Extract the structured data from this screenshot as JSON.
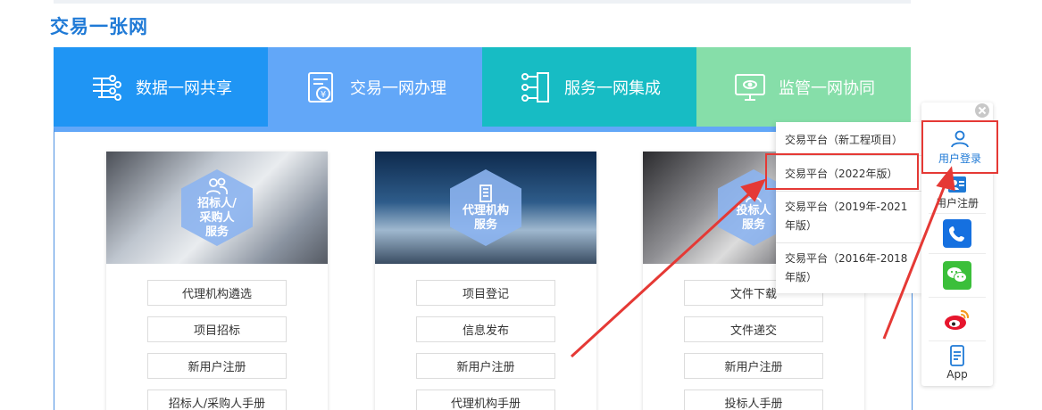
{
  "section": {
    "title": "交易一张网"
  },
  "tabs": [
    {
      "label": "数据一网共享",
      "icon": "data-share-icon"
    },
    {
      "label": "交易一网办理",
      "icon": "transaction-icon"
    },
    {
      "label": "服务一网集成",
      "icon": "service-integration-icon"
    },
    {
      "label": "监管一网协同",
      "icon": "monitor-icon"
    }
  ],
  "cards": [
    {
      "badge_line1": "招标人/",
      "badge_line2": "采购人",
      "badge_line3": "服务",
      "links": [
        "代理机构遴选",
        "项目招标",
        "新用户注册",
        "招标人/采购人手册"
      ]
    },
    {
      "badge_line1": "代理机构",
      "badge_line2": "服务",
      "links": [
        "项目登记",
        "信息发布",
        "新用户注册",
        "代理机构手册"
      ]
    },
    {
      "badge_line1": "投标人",
      "badge_line2": "服务",
      "links": [
        "文件下载",
        "文件递交",
        "新用户注册",
        "投标人手册"
      ]
    }
  ],
  "dropdown": {
    "items": [
      "交易平台（新工程项目）",
      "交易平台（2022年版）",
      "交易平台（2019年-2021年版）",
      "交易平台（2016年-2018年版）"
    ]
  },
  "sidebar": {
    "login_label": "用户登录",
    "register_label": "用户注册",
    "app_label": "App"
  },
  "colors": {
    "tab1": "#1f95f4",
    "tab2": "#62a7f8",
    "tab3": "#17bcc4",
    "tab4": "#86dea9",
    "accent": "#1f7ad6",
    "highlight": "#e53935"
  }
}
